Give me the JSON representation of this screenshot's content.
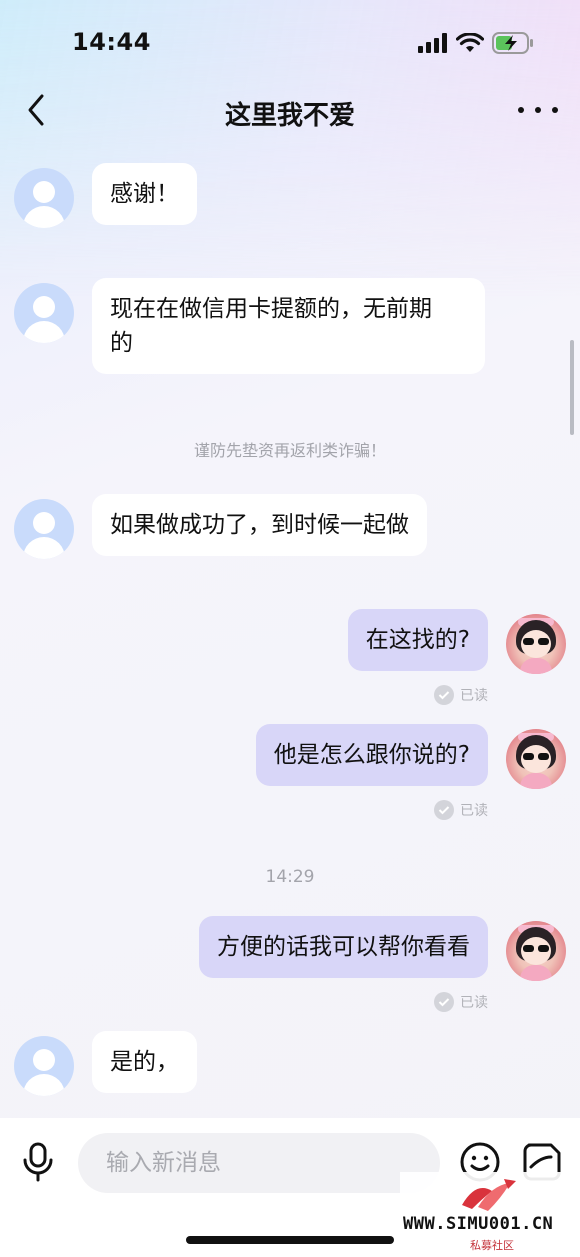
{
  "status_bar": {
    "time": "14:44"
  },
  "header": {
    "title": "这里我不爱"
  },
  "messages": [
    {
      "direction": "in",
      "text": "感谢！"
    },
    {
      "direction": "in",
      "text_lines": [
        "现在在做信用卡提额的，无前期",
        "的"
      ]
    },
    {
      "direction": "in",
      "text": "如果做成功了，到时候一起做"
    },
    {
      "direction": "out",
      "text": "在这找的?",
      "read_label": "已读"
    },
    {
      "direction": "out",
      "text": "他是怎么跟你说的?",
      "read_label": "已读"
    },
    {
      "direction": "out",
      "text": "方便的话我可以帮你看看",
      "read_label": "已读"
    },
    {
      "direction": "in",
      "text": "是的，"
    }
  ],
  "system_notice": "谨防先垫资再返利类诈骗！",
  "timestamp": "14:29",
  "composer": {
    "placeholder": "输入新消息"
  },
  "watermark": {
    "text": "WWW.SIMU001.CN",
    "subtext": "私募社区"
  },
  "colors": {
    "outgoing_bubble": "#d8d6f8",
    "incoming_bubble": "#ffffff",
    "incoming_avatar": "#c9dbfb"
  }
}
